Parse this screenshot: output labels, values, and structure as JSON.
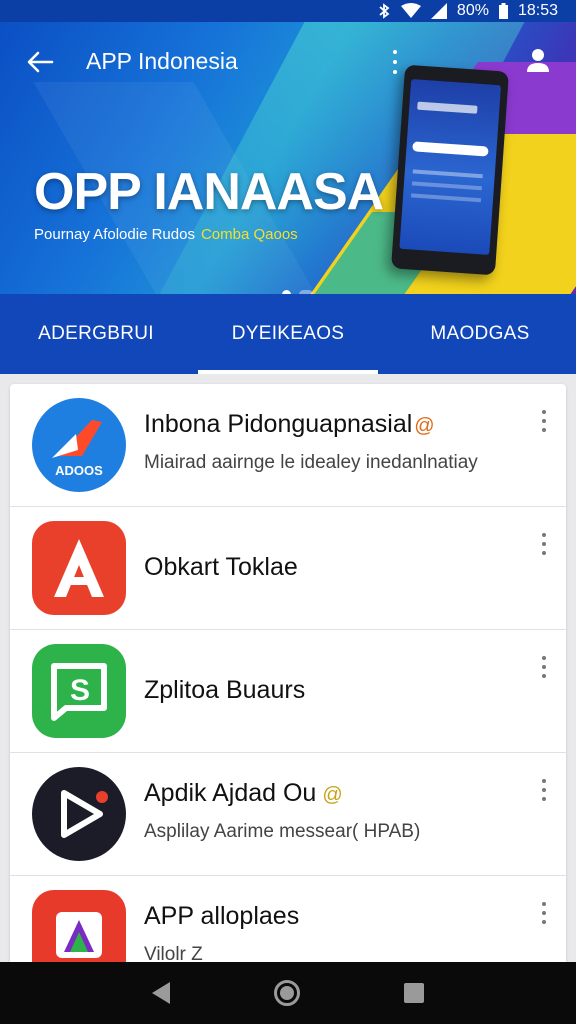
{
  "status_bar": {
    "battery": "80%",
    "time": "18:53"
  },
  "header": {
    "title": "APP Indonesia"
  },
  "banner": {
    "title": "OPP IANAASA",
    "subtitle": "Pournay Afolodie Rudos",
    "subtitle_highlight": "Comba Qaoos",
    "accent_color": "#f2d21c"
  },
  "tabs": [
    {
      "label": "ADERGBRUI",
      "active": false
    },
    {
      "label": "DYEIKEAOS",
      "active": true
    },
    {
      "label": "MAODGAS",
      "active": false
    }
  ],
  "apps": [
    {
      "name": "Inbona Pidonguapnasial",
      "badge": "@",
      "description": "Miairad aairnge le idealey inedanlnatiay",
      "icon": "rocket-icon",
      "icon_text": "ADOOS",
      "icon_color": "#1f7fe0"
    },
    {
      "name": "Obkart Toklae",
      "badge": "",
      "description": "",
      "icon": "letter-a-icon",
      "icon_text": "A",
      "icon_color": "#e8402a"
    },
    {
      "name": "Zplitoa Buaurs",
      "badge": "",
      "description": "",
      "icon": "chat-s-icon",
      "icon_text": "S",
      "icon_color": "#2db34a"
    },
    {
      "name": "Apdik Ajdad Ou",
      "badge": "@",
      "description": "Asplilay Aarime messear( HPAB)",
      "icon": "play-icon",
      "icon_text": "",
      "icon_color": "#1c1c28"
    },
    {
      "name": "APP alloplaes",
      "badge": "",
      "description": "Vilolr Z",
      "icon": "triangle-icon",
      "icon_text": "",
      "icon_color": "#e83a2a"
    }
  ]
}
